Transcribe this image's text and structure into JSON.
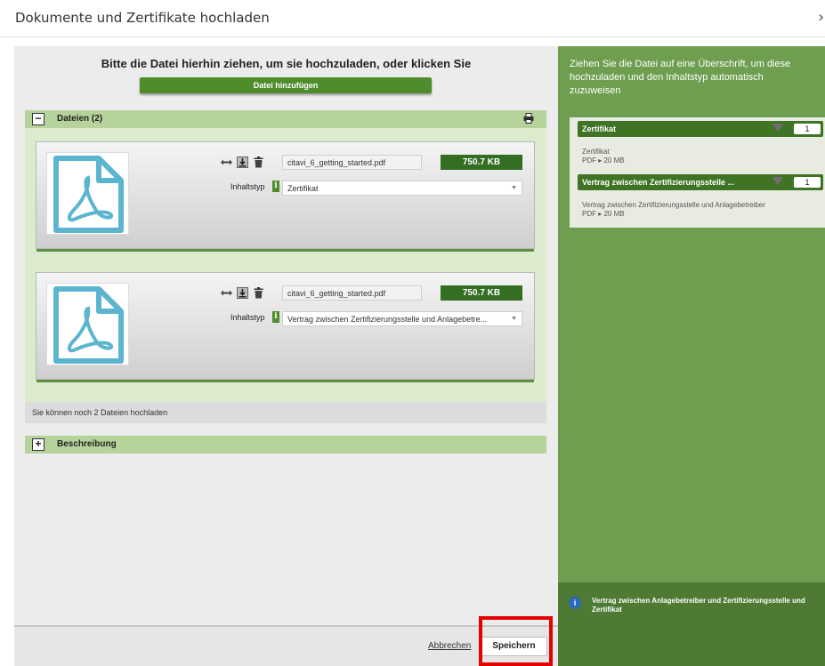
{
  "dialog": {
    "title": "Dokumente und Zertifikate hochladen",
    "close_glyph": "›"
  },
  "upload": {
    "drop_text": "Bitte die Datei hierhin ziehen, um sie hochzuladen, oder klicken Sie",
    "add_button": "Datei hinzufügen"
  },
  "files_section": {
    "label": "Dateien (2)",
    "toggle": "−",
    "files": [
      {
        "name": "citavi_6_getting_started.pdf",
        "size": "750.7 KB",
        "type_label": "Inhaltstyp",
        "type_value": "Zertifikat"
      },
      {
        "name": "citavi_6_getting_started.pdf",
        "size": "750.7 KB",
        "type_label": "Inhaltstyp",
        "type_value": "Vertrag zwischen Zertifizierungsstelle und Anlagebetre..."
      }
    ],
    "remaining": "Sie können noch 2 Dateien hochladen"
  },
  "description_section": {
    "label": "Beschreibung",
    "toggle": "+"
  },
  "footer": {
    "cancel": "Abbrechen",
    "save": "Speichern"
  },
  "right_panel": {
    "intro": "Ziehen Sie die Datei auf eine Überschrift, um diese hochzuladen und den Inhaltstyp automatisch zuzuweisen",
    "categories": [
      {
        "title": "Zertifikat",
        "count": "1",
        "desc_line1": "Zertifikat",
        "desc_line2": "PDF ▸ 20 MB"
      },
      {
        "title": "Vertrag zwischen Zertifizierungsstelle ...",
        "count": "1",
        "desc_line1": "Vertrag zwischen Zertifizierungsstelle und Anlagebetreiber",
        "desc_line2": "PDF ▸ 20 MB"
      }
    ],
    "info_text": "Vertrag zwischen Anlagebetreiber und Zertifizierungsstelle und Zertifikat"
  },
  "colors": {
    "accent_green": "#4f8c2c",
    "dark_green": "#336e22",
    "panel_green": "#6e9e4f",
    "highlight_red": "#e60000"
  }
}
